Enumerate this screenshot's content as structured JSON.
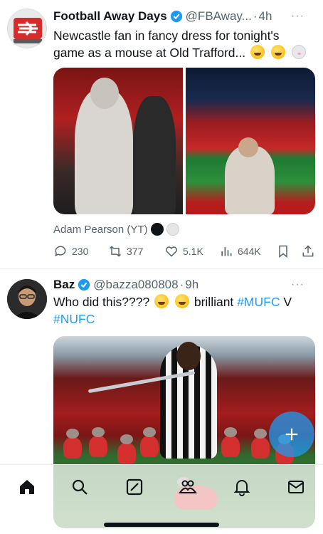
{
  "tweets": [
    {
      "author": {
        "name": "Football Away Days",
        "handle": "@FBAway...",
        "verified": true,
        "verified_color": "#1d9bf0"
      },
      "time": "4h",
      "text": "Newcastle fan in fancy dress for tonight's game as a mouse at Old Trafford...",
      "emojis": [
        "rolling-on-floor-laughing-emoji",
        "loudly-crying-emoji",
        "mouse-face-emoji"
      ],
      "media_credit": "Adam Pearson (YT)",
      "stats": {
        "replies": "230",
        "reposts": "377",
        "likes": "5.1K",
        "views": "644K"
      }
    },
    {
      "author": {
        "name": "Baz",
        "handle": "@bazza080808",
        "verified": true
      },
      "time": "9h",
      "text_parts": [
        "Who did this????",
        "brilliant",
        "#MUFC",
        "V",
        "#NUFC"
      ],
      "emojis": [
        "rolling-on-floor-laughing-emoji",
        "rolling-on-floor-laughing-emoji"
      ]
    }
  ],
  "ui": {
    "separator": "·",
    "more": "···",
    "accent": "#1d9bf0"
  },
  "tabbar": [
    "home",
    "search",
    "grok",
    "communities",
    "notifications",
    "messages"
  ]
}
